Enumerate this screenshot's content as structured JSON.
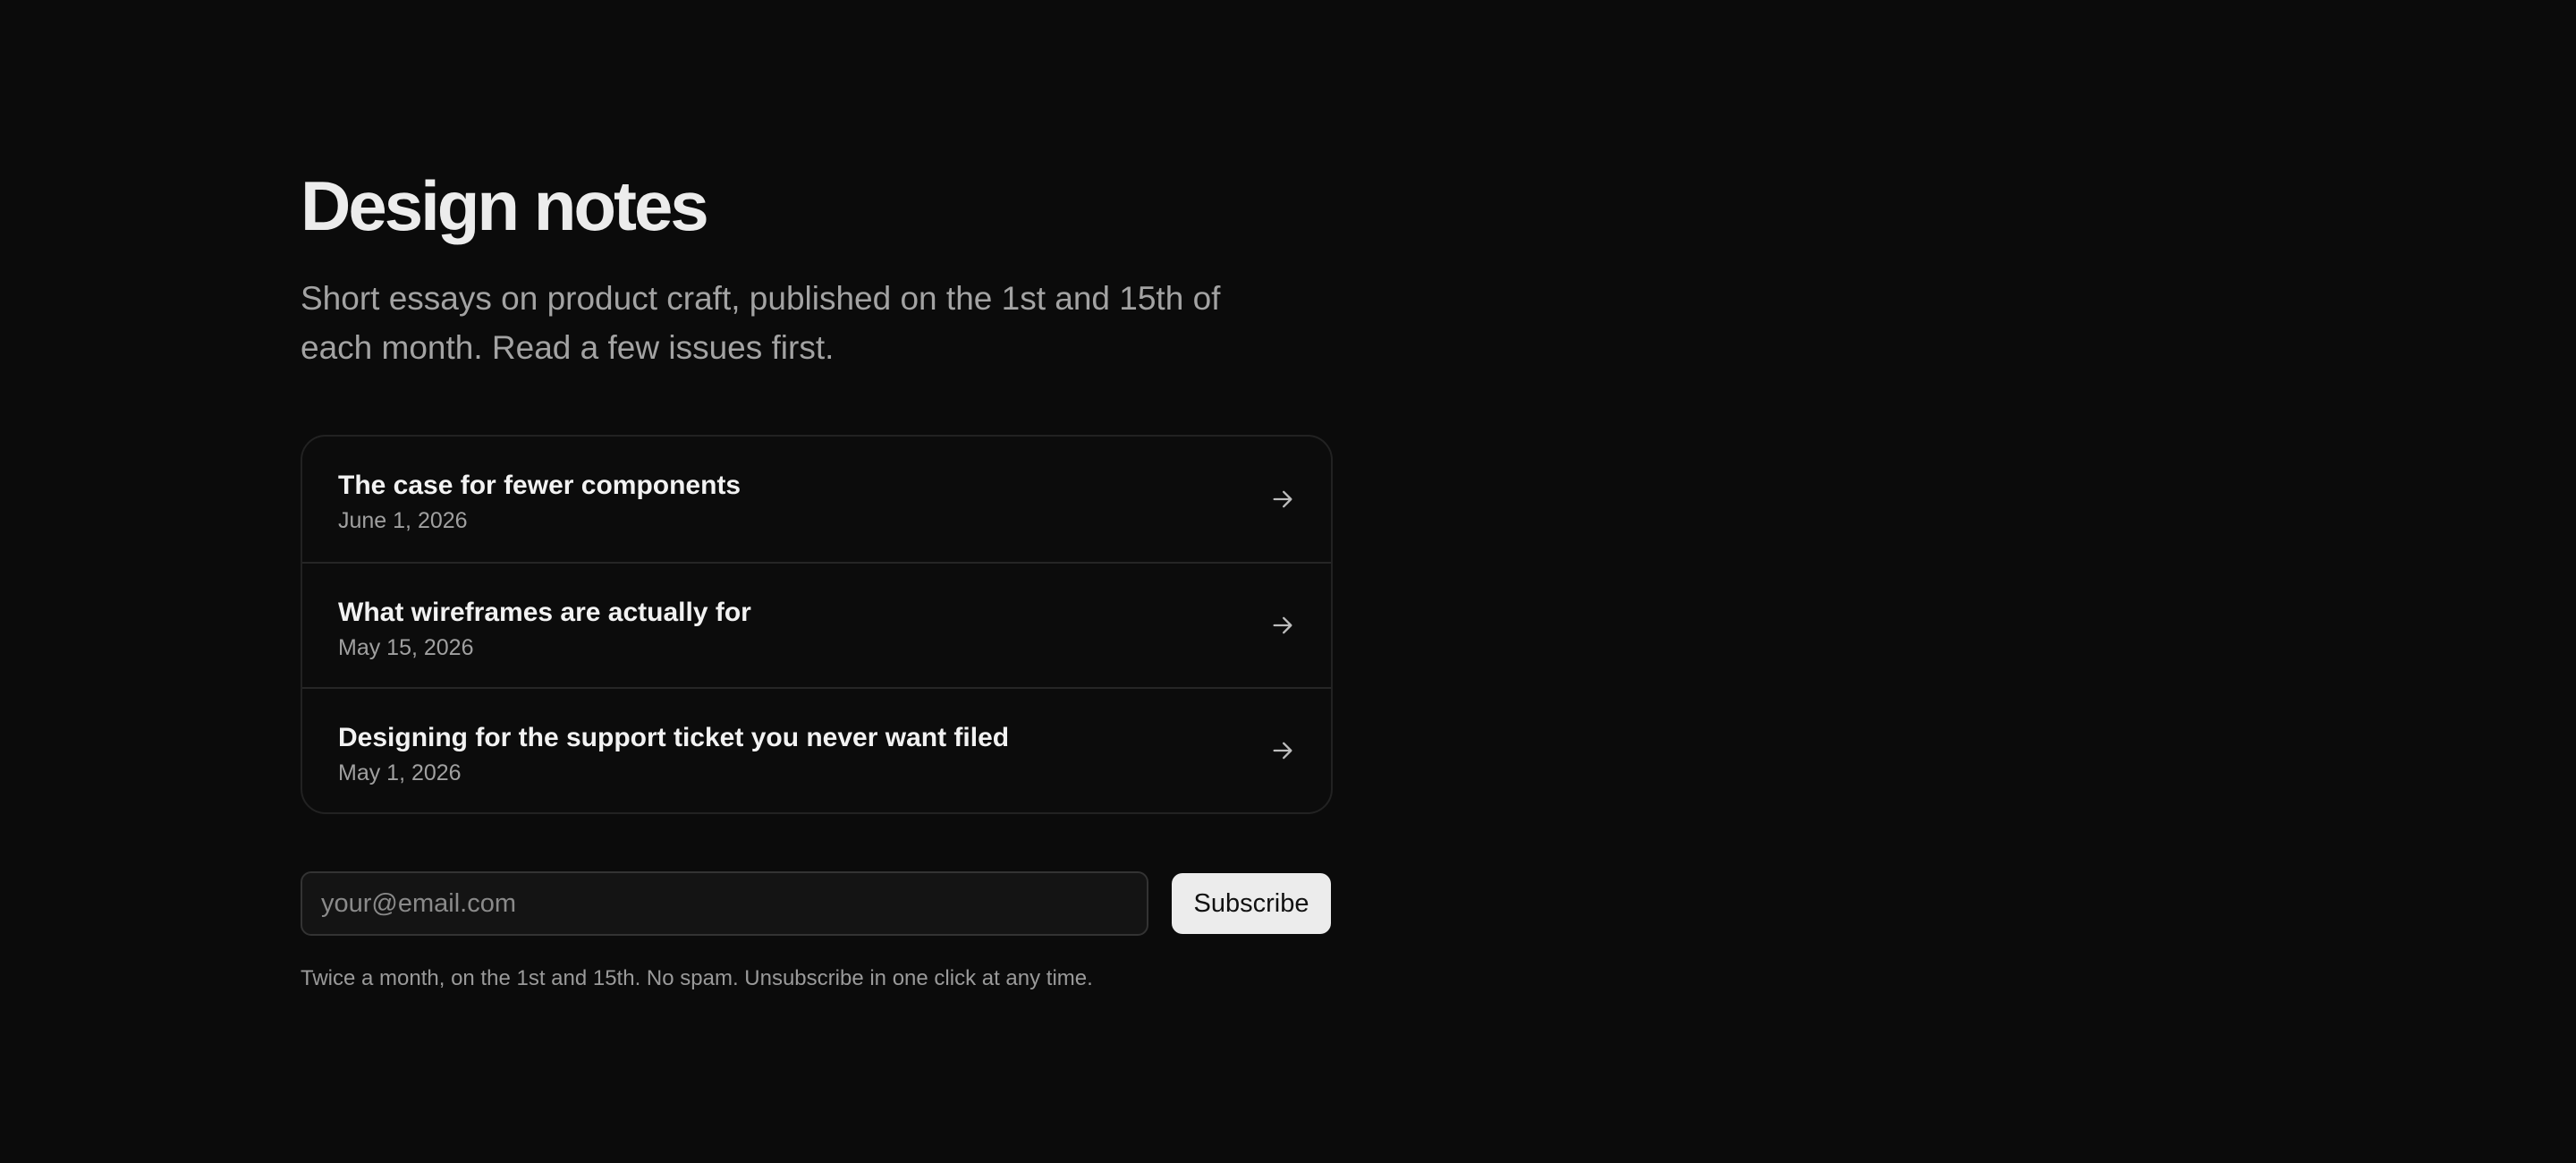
{
  "header": {
    "title": "Design notes",
    "subtitle": "Short essays on product craft, published on the 1st and 15th of each month. Read a few issues first."
  },
  "issues": [
    {
      "title": "The case for fewer components",
      "date": "June 1, 2026",
      "icon": "arrow-right-icon"
    },
    {
      "title": "What wireframes are actually for",
      "date": "May 15, 2026",
      "icon": "arrow-right-icon"
    },
    {
      "title": "Designing for the support ticket you never want filed",
      "date": "May 1, 2026",
      "icon": "arrow-right-icon"
    }
  ],
  "subscribe": {
    "email_placeholder": "your@email.com",
    "email_value": "",
    "button_label": "Subscribe",
    "note": "Twice a month, on the 1st and 15th. No spam. Unsubscribe in one click at any time."
  },
  "colors": {
    "background": "#0b0b0b",
    "title": "#ececec",
    "muted_text": "#a3a3a3",
    "card_border": "#222222",
    "button_bg": "#ececec",
    "button_text": "#111111"
  }
}
